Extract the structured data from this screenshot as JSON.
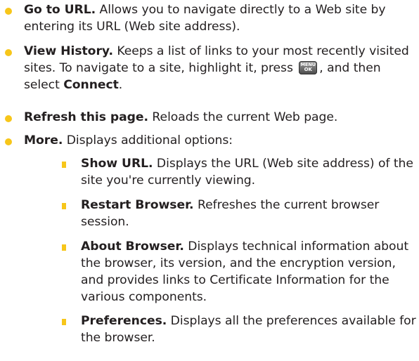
{
  "bullet_color": "#f7c61a",
  "items": [
    {
      "term": "Go to URL.",
      "text": " Allows you to navigate directly to a Web site by entering its URL (Web site address)."
    },
    {
      "term": "View History.",
      "text_before": " Keeps a list of links to your most recently visited sites. To navigate to a site, highlight it, press ",
      "key_icon": {
        "icon": "menu-ok-key-icon",
        "line1": "MENU",
        "line2": "OK"
      },
      "text_after": ", and then select ",
      "term2": "Connect",
      "text_end": "."
    },
    {
      "term": "Refresh this page.",
      "text": " Reloads the current Web page."
    },
    {
      "term": "More.",
      "text": " Displays additional options:"
    }
  ],
  "subitems": [
    {
      "term": "Show URL.",
      "text": " Displays the URL (Web site address) of the site you're currently viewing."
    },
    {
      "term": "Restart Browser.",
      "text": " Refreshes the current browser session."
    },
    {
      "term": "About Browser.",
      "text": " Displays technical information about the browser, its version, and the encryption version, and provides links to Certificate Information for the various components."
    },
    {
      "term": "Preferences.",
      "text": " Displays all the preferences available for the browser."
    }
  ]
}
